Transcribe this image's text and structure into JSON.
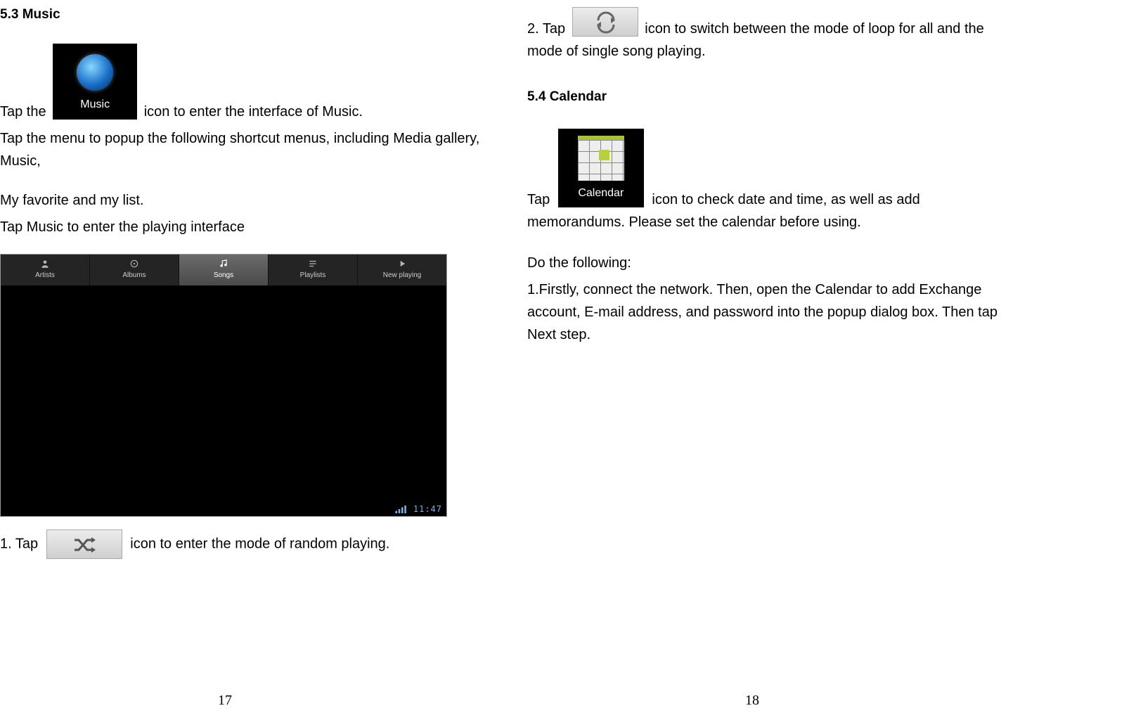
{
  "left": {
    "heading": "5.3 Music",
    "tap_the": "Tap the",
    "music_icon_label": "Music",
    "after_music_icon": " icon to enter the interface of Music.",
    "para2": "Tap the menu to popup the following shortcut menus, including Media gallery, Music,",
    "para3": "My favorite and my list.",
    "para4": "Tap Music to enter the playing interface",
    "tabs": {
      "artists": "Artists",
      "albums": "Albums",
      "songs": "Songs",
      "playlists": "Playlists",
      "nowplaying": "New playing"
    },
    "statusbar_time": "11:47",
    "step1_prefix": "1. Tap",
    "step1_suffix": " icon to enter the mode of random playing.",
    "page_number": "17"
  },
  "right": {
    "step2_prefix": "2. Tap",
    "step2_suffix": " icon to switch between the mode of loop for all and the mode of single song playing.",
    "heading": "5.4 Calendar",
    "tap": "Tap",
    "calendar_icon_label": "Calendar",
    "after_calendar_icon": " icon to check date and time, as well as add memorandums. Please set the calendar before using.",
    "do_following": "Do the following:",
    "step1_right": "1.Firstly, connect the network. Then, open the Calendar to add Exchange account, E-mail address, and password into the popup dialog box. Then tap Next step.",
    "page_number": "18"
  }
}
